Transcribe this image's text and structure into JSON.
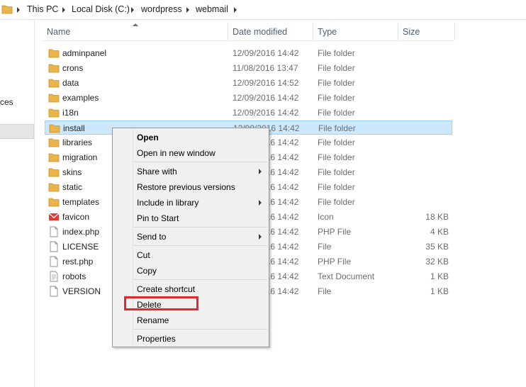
{
  "breadcrumb": [
    "This PC",
    "Local Disk (C:)",
    "wordpress",
    "webmail"
  ],
  "nav": {
    "partial_text": "ces"
  },
  "columns": {
    "name": "Name",
    "date": "Date modified",
    "type": "Type",
    "size": "Size"
  },
  "files": [
    {
      "name": "adminpanel",
      "date": "12/09/2016 14:42",
      "type": "File folder",
      "size": "",
      "icon": "folder-icon"
    },
    {
      "name": "crons",
      "date": "11/08/2016 13:47",
      "type": "File folder",
      "size": "",
      "icon": "folder-icon"
    },
    {
      "name": "data",
      "date": "12/09/2016 14:52",
      "type": "File folder",
      "size": "",
      "icon": "folder-icon"
    },
    {
      "name": "examples",
      "date": "12/09/2016 14:42",
      "type": "File folder",
      "size": "",
      "icon": "folder-icon"
    },
    {
      "name": "i18n",
      "date": "12/09/2016 14:42",
      "type": "File folder",
      "size": "",
      "icon": "folder-icon"
    },
    {
      "name": "install",
      "date": "12/09/2016 14:42",
      "type": "File folder",
      "size": "",
      "icon": "folder-icon"
    },
    {
      "name": "libraries",
      "date": "12/09/2016 14:42",
      "type": "File folder",
      "size": "",
      "icon": "folder-icon"
    },
    {
      "name": "migration",
      "date": "12/09/2016 14:42",
      "type": "File folder",
      "size": "",
      "icon": "folder-icon"
    },
    {
      "name": "skins",
      "date": "12/09/2016 14:42",
      "type": "File folder",
      "size": "",
      "icon": "folder-icon"
    },
    {
      "name": "static",
      "date": "12/09/2016 14:42",
      "type": "File folder",
      "size": "",
      "icon": "folder-icon"
    },
    {
      "name": "templates",
      "date": "12/09/2016 14:42",
      "type": "File folder",
      "size": "",
      "icon": "folder-icon"
    },
    {
      "name": "favicon",
      "date": "12/09/2016 14:42",
      "type": "Icon",
      "size": "18 KB",
      "icon": "mail-icon"
    },
    {
      "name": "index.php",
      "date": "12/09/2016 14:42",
      "type": "PHP File",
      "size": "4 KB",
      "icon": "file-icon"
    },
    {
      "name": "LICENSE",
      "date": "12/09/2016 14:42",
      "type": "File",
      "size": "35 KB",
      "icon": "file-icon"
    },
    {
      "name": "rest.php",
      "date": "12/09/2016 14:42",
      "type": "PHP File",
      "size": "32 KB",
      "icon": "file-icon"
    },
    {
      "name": "robots",
      "date": "12/09/2016 14:42",
      "type": "Text Document",
      "size": "1 KB",
      "icon": "text-file-icon"
    },
    {
      "name": "VERSION",
      "date": "12/09/2016 14:42",
      "type": "File",
      "size": "1 KB",
      "icon": "file-icon"
    }
  ],
  "context_menu": {
    "open": "Open",
    "open_new_window": "Open in new window",
    "share_with": "Share with",
    "restore_previous_versions": "Restore previous versions",
    "include_in_library": "Include in library",
    "pin_to_start": "Pin to Start",
    "send_to": "Send to",
    "cut": "Cut",
    "copy": "Copy",
    "create_shortcut": "Create shortcut",
    "delete": "Delete",
    "rename": "Rename",
    "properties": "Properties"
  },
  "colors": {
    "selection": "#cce8ff",
    "highlight_box": "#e8262b",
    "folder": "#e8b54b"
  }
}
